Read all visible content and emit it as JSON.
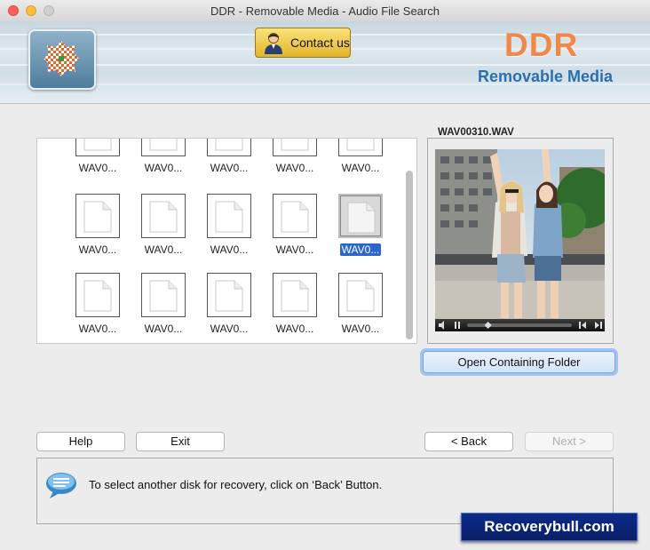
{
  "window": {
    "title": "DDR - Removable Media - Audio File Search"
  },
  "header": {
    "contact_label": "Contact us",
    "brand_main": "DDR",
    "brand_sub": "Removable Media",
    "logo_icon": "checker-disc-icon",
    "contact_icon": "person-icon"
  },
  "gallery": {
    "rows": [
      [
        "WAV0...",
        "WAV0...",
        "WAV0...",
        "WAV0...",
        "WAV0..."
      ],
      [
        "WAV0...",
        "WAV0...",
        "WAV0...",
        "WAV0...",
        "WAV0..."
      ],
      [
        "WAV0...",
        "WAV0...",
        "WAV0...",
        "WAV0...",
        "WAV0..."
      ]
    ],
    "selected_index": 9
  },
  "preview": {
    "title": "WAV00310.WAV",
    "open_folder_label": "Open Containing Folder",
    "playback_progress": 0.2
  },
  "buttons": {
    "help": "Help",
    "exit": "Exit",
    "back": "< Back",
    "next": "Next >"
  },
  "status": {
    "message": "To select another disk for recovery, click on ‘Back’ Button.",
    "icon": "speech-bubble-icon"
  },
  "watermark": {
    "text": "Recoverybull.com"
  }
}
